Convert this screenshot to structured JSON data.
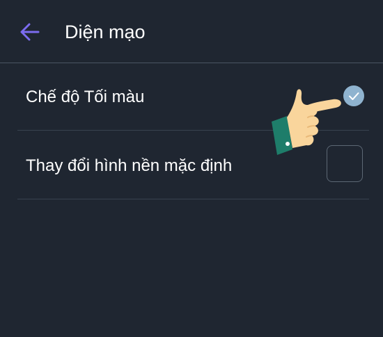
{
  "header": {
    "title": "Diện mạo",
    "back_icon": "arrow-left-icon",
    "back_color": "#7c6cf0"
  },
  "settings": [
    {
      "label": "Chế độ Tối màu",
      "checked": true
    },
    {
      "label": "Thay đổi hình nền mặc định",
      "checked": false
    }
  ],
  "colors": {
    "background": "#1f2631",
    "text": "#ffffff",
    "check_on": "#8fb3cf",
    "hand_skin": "#f9d59c",
    "hand_cuff": "#1e7d6a"
  },
  "overlay": {
    "icon": "pointing-hand-icon"
  }
}
